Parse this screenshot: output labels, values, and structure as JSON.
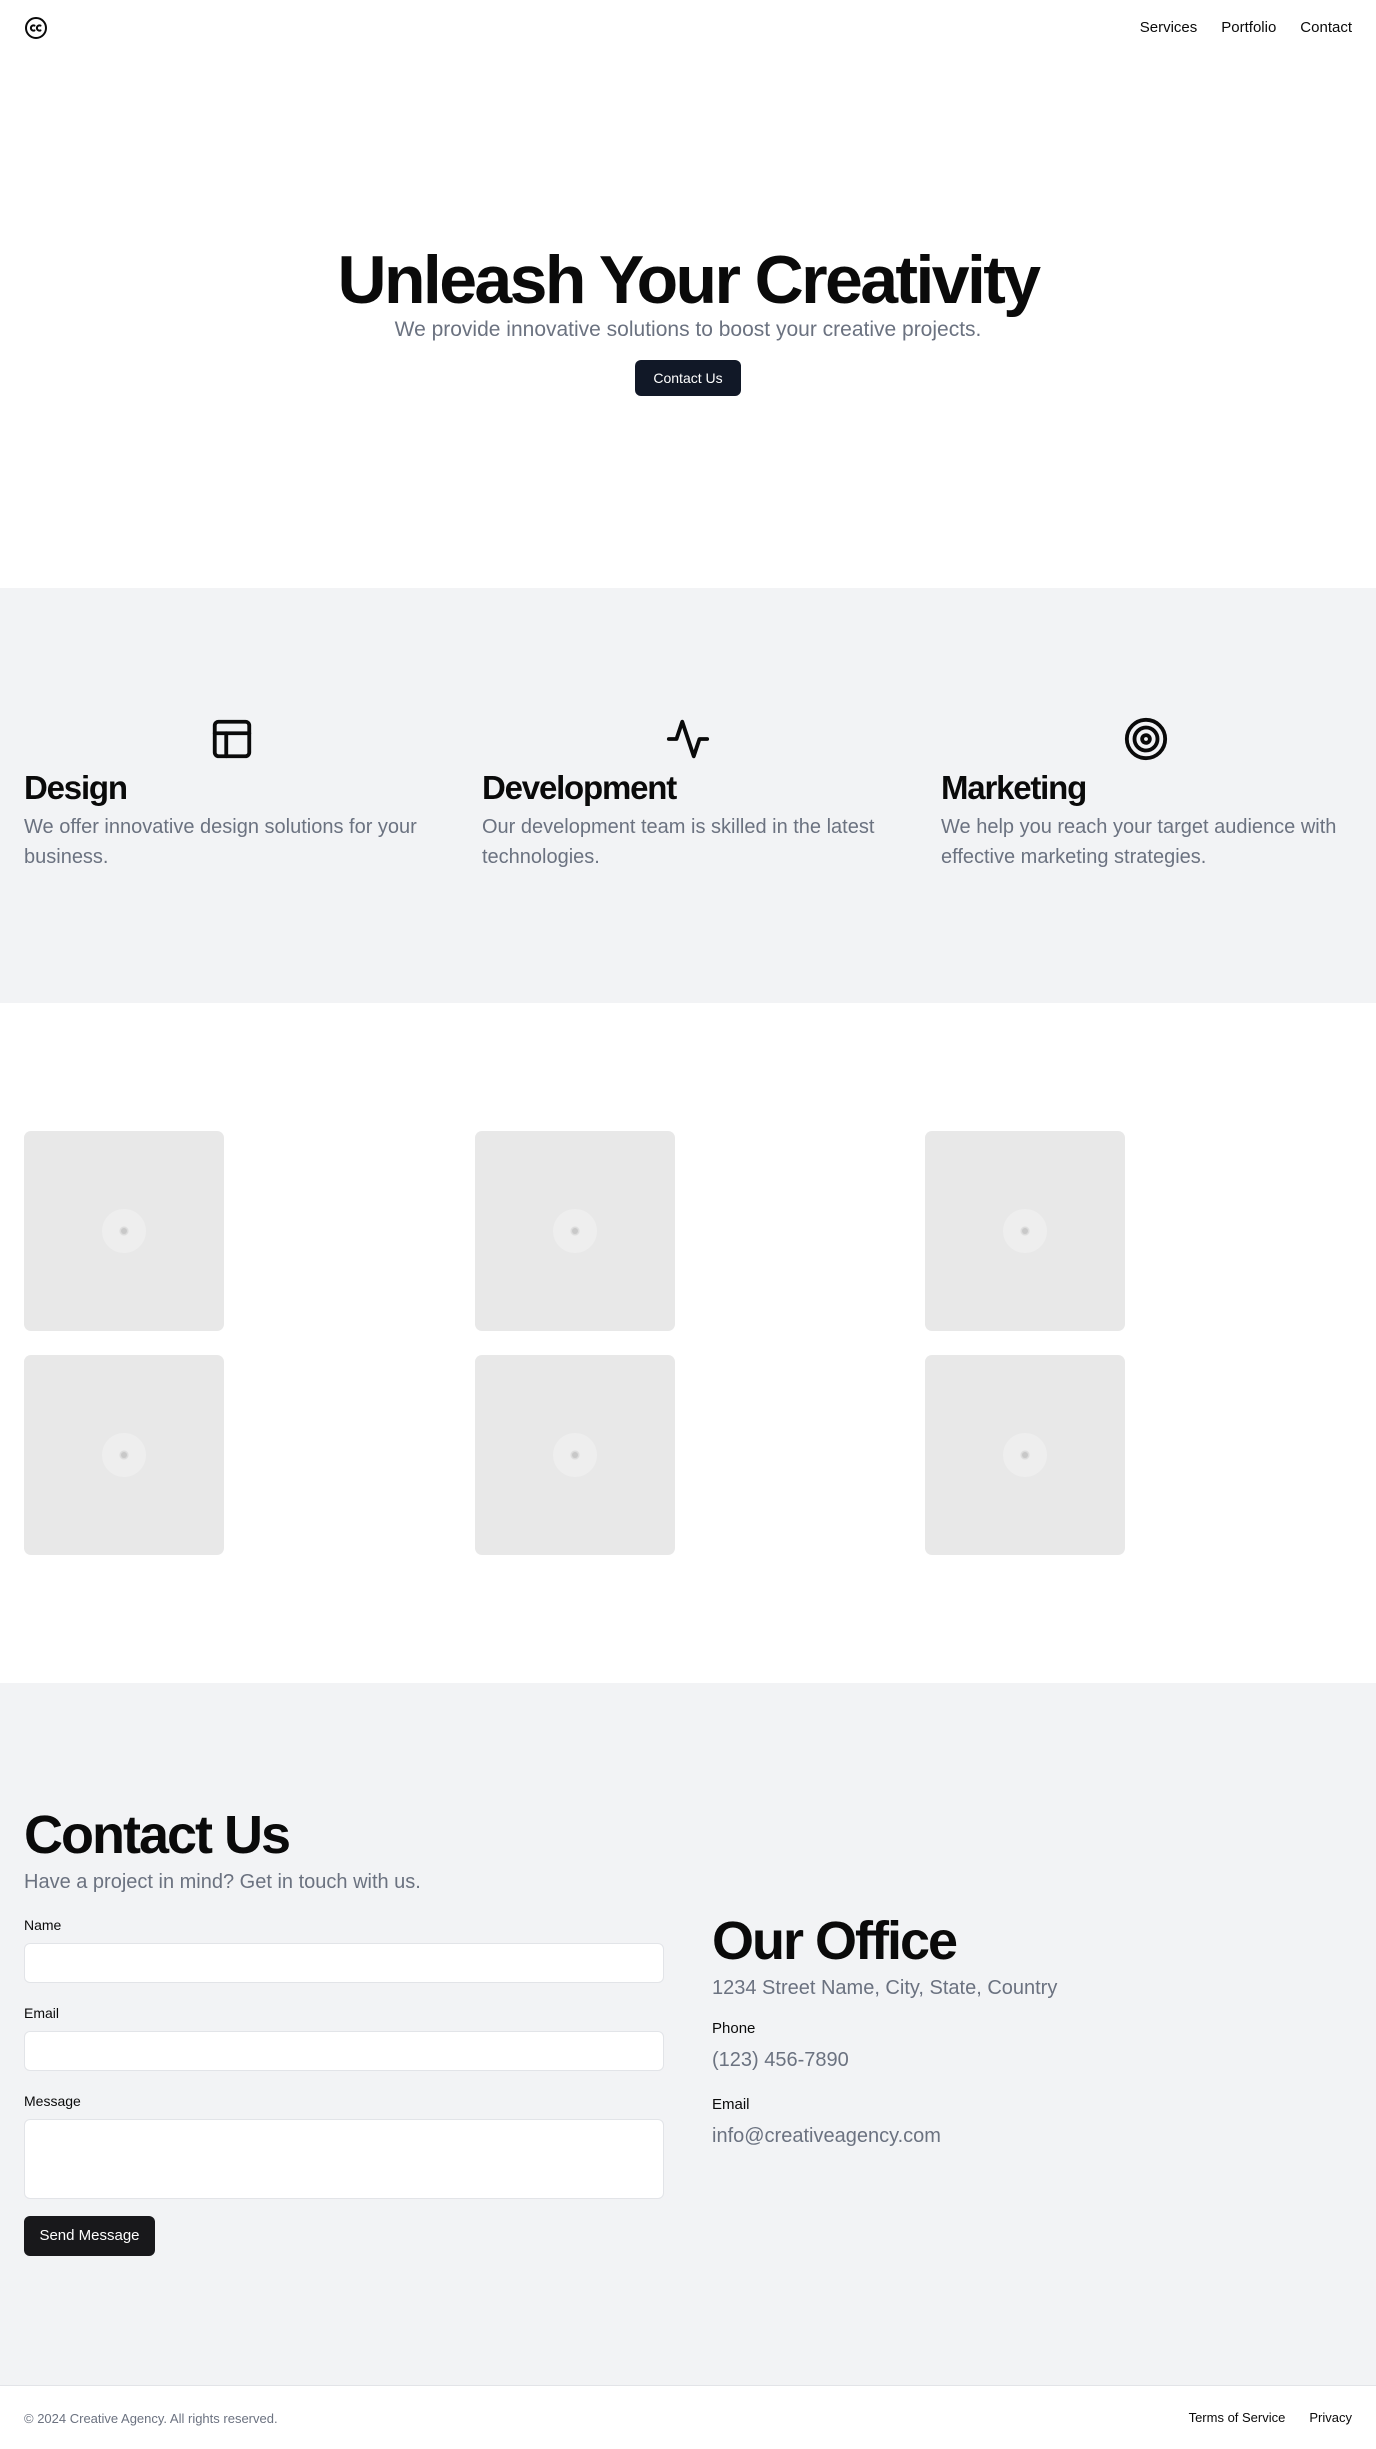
{
  "header": {
    "logo_icon": "creative-commons-icon",
    "nav": [
      "Services",
      "Portfolio",
      "Contact"
    ]
  },
  "hero": {
    "title": "Unleash Your Creativity",
    "subtitle": "We provide innovative solutions to boost your creative projects.",
    "cta": "Contact Us"
  },
  "services": [
    {
      "icon": "layout-icon",
      "title": "Design",
      "text": "We offer innovative design solutions for your business."
    },
    {
      "icon": "activity-icon",
      "title": "Development",
      "text": "Our development team is skilled in the latest technologies."
    },
    {
      "icon": "target-icon",
      "title": "Marketing",
      "text": "We help you reach your target audience with effective marketing strategies."
    }
  ],
  "portfolio": {
    "count": 6,
    "placeholder_icon": "image-placeholder-icon"
  },
  "contact": {
    "title": "Contact Us",
    "subtitle": "Have a project in mind? Get in touch with us.",
    "name_label": "Name",
    "name_value": "",
    "email_label": "Email",
    "email_value": "",
    "message_label": "Message",
    "message_value": "",
    "send_label": "Send Message"
  },
  "office": {
    "title": "Our Office",
    "address": "1234 Street Name, City, State, Country",
    "phone_label": "Phone",
    "phone": "(123) 456-7890",
    "email_label": "Email",
    "email": "info@creativeagency.com"
  },
  "footer": {
    "copyright": "© 2024 Creative Agency. All rights reserved.",
    "links": [
      "Terms of Service",
      "Privacy"
    ]
  },
  "colors": {
    "accent": "#111827",
    "muted_text": "#6b7280",
    "section_bg": "#f2f3f5",
    "placeholder_bg": "#e8e8e8"
  }
}
